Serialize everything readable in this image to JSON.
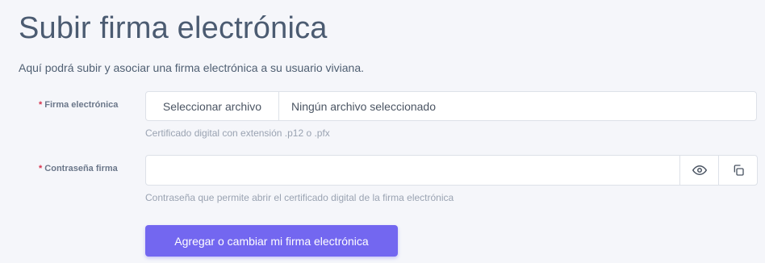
{
  "page": {
    "title": "Subir firma electrónica",
    "subtitle": "Aquí podrá subir y asociar una firma electrónica a su usuario viviana."
  },
  "fields": {
    "certificate": {
      "required_mark": "*",
      "label": "Firma electrónica",
      "button_label": "Seleccionar archivo",
      "file_status": "Ningún archivo seleccionado",
      "help": "Certificado digital con extensión .p12 o .pfx"
    },
    "password": {
      "required_mark": "*",
      "label": "Contraseña firma",
      "value": "",
      "help": "Contraseña que permite abrir el certificado digital de la firma electrónica",
      "toggle_icon": "eye-icon",
      "copy_icon": "copy-icon"
    }
  },
  "actions": {
    "submit_label": "Agregar o cambiar mi firma electrónica"
  },
  "colors": {
    "primary": "#7367f0",
    "required": "#d6334e",
    "title": "#4b5b71",
    "help": "#9aa3b2"
  }
}
